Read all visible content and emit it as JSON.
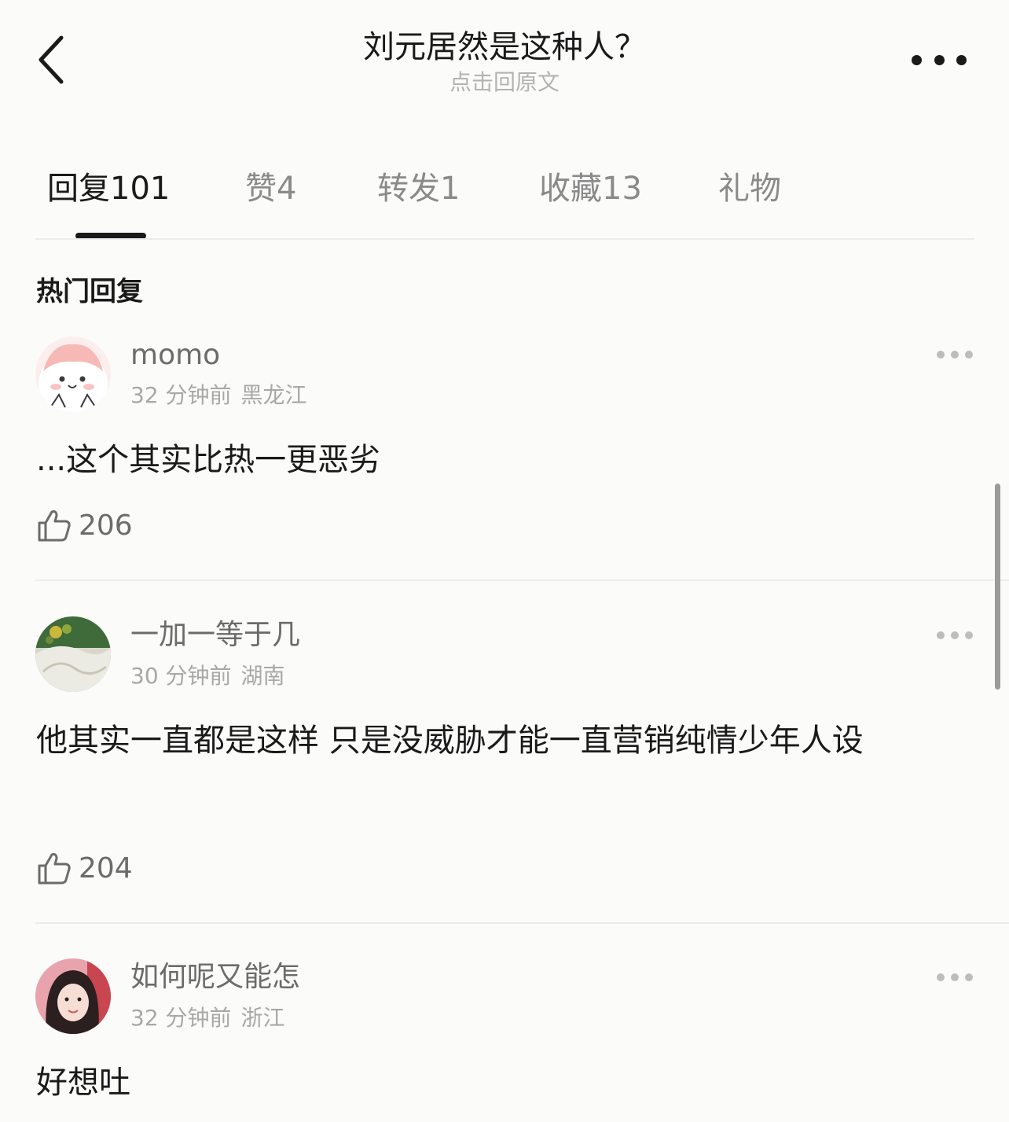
{
  "header": {
    "title": "刘元居然是这种人？",
    "subtitle": "点击回原文"
  },
  "tabs": [
    {
      "label": "回复",
      "count": "101",
      "active": true
    },
    {
      "label": "赞",
      "count": "4",
      "active": false
    },
    {
      "label": "转发",
      "count": "1",
      "active": false
    },
    {
      "label": "收藏",
      "count": "13",
      "active": false
    },
    {
      "label": "礼物",
      "count": "",
      "active": false
    }
  ],
  "section_title": "热门回复",
  "comments": [
    {
      "username": "momo",
      "time": "32 分钟前",
      "location": "黑龙江",
      "content": "...这个其实比热一更恶劣",
      "likes": "206",
      "avatar": "cartoon-face-avatar"
    },
    {
      "username": "一加一等于几",
      "time": "30 分钟前",
      "location": "湖南",
      "content": "他其实一直都是这样 只是没威胁才能一直营销纯情少年人设",
      "likes": "204",
      "avatar": "flowers-photo-avatar"
    },
    {
      "username": "如何呢又能怎",
      "time": "32 分钟前",
      "location": "浙江",
      "content": "好想吐",
      "likes": "",
      "avatar": "girl-photo-avatar"
    }
  ],
  "icons": {
    "back": "chevron-left-icon",
    "more": "more-horizontal-icon",
    "like": "thumbs-up-icon"
  },
  "colors": {
    "background": "#fbfbfa",
    "text_primary": "#1a1a1a",
    "text_secondary": "#8a8a8a",
    "divider": "#ececec"
  }
}
